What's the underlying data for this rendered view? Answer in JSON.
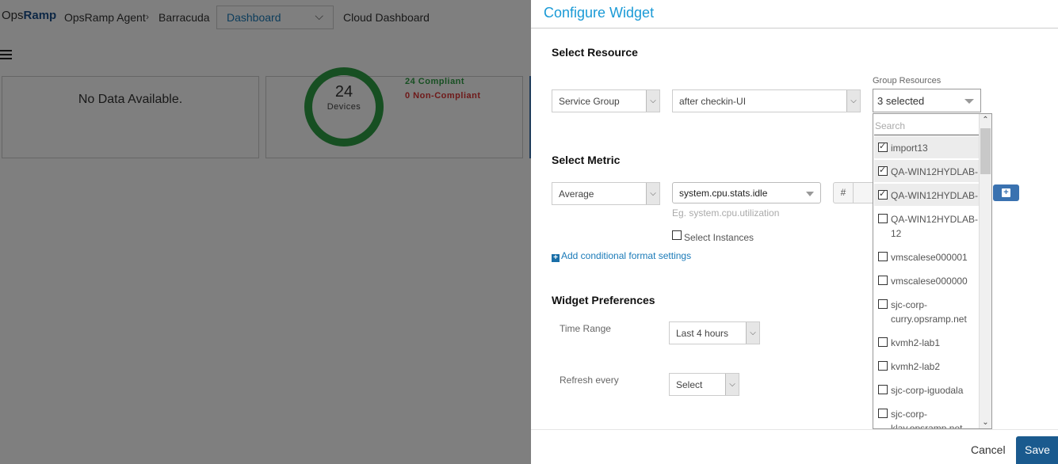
{
  "background": {
    "logo": {
      "prefix": "Ops",
      "suffix": "Ramp"
    },
    "breadcrumb": [
      "OpsRamp Agent",
      "Barracuda"
    ],
    "breadcrumb_separator": "›",
    "dashboard_select": {
      "value": "Dashboard"
    },
    "cloud_dashboard_link": "Cloud Dashboard",
    "widgets": [
      {
        "type": "no-data",
        "message": "No Data Available."
      },
      {
        "type": "compliance",
        "count": "24",
        "count_label": "Devices",
        "compliant": "24 Compliant",
        "non_compliant": "0 Non-Compliant",
        "compliant_color": "#2e9e44",
        "non_compliant_color": "#dd3333"
      }
    ]
  },
  "panel": {
    "title": "Configure Widget",
    "select_resource": {
      "heading": "Select Resource",
      "resource_type": "Service Group",
      "resource_name": "after checkin-UI",
      "group_resources": {
        "label": "Group Resources",
        "value": "3 selected",
        "search_placeholder": "Search",
        "items": [
          {
            "label": "import13",
            "checked": true
          },
          {
            "label": "QA-WIN12HYDLAB-",
            "checked": true
          },
          {
            "label": "QA-WIN12HYDLAB-",
            "checked": true
          },
          {
            "label": "QA-WIN12HYDLAB-12",
            "checked": false
          },
          {
            "label": "vmscalese000001",
            "checked": false
          },
          {
            "label": "vmscalese000000",
            "checked": false
          },
          {
            "label": "sjc-corp-curry.opsramp.net",
            "checked": false
          },
          {
            "label": "kvmh2-lab1",
            "checked": false
          },
          {
            "label": "kvmh2-lab2",
            "checked": false
          },
          {
            "label": "sjc-corp-iguodala",
            "checked": false
          },
          {
            "label": "sjc-corp-klay.opsramp.net",
            "checked": false
          }
        ]
      }
    },
    "select_metric": {
      "heading": "Select Metric",
      "aggregation": "Average",
      "metric": "system.cpu.stats.idle",
      "metric_hint": "Eg. system.cpu.utilization",
      "hash_label": "#",
      "select_instances_label": "Select Instances",
      "select_instances_checked": false,
      "add_conditional_label": "Add conditional format settings"
    },
    "widget_preferences": {
      "heading": "Widget Preferences",
      "time_range_label": "Time Range",
      "time_range_value": "Last 4 hours",
      "refresh_label": "Refresh every",
      "refresh_value": "Select"
    },
    "footer": {
      "cancel_label": "Cancel",
      "save_label": "Save"
    },
    "accent_color": "#1a9ad6",
    "primary_button_color": "#1a5a8e"
  }
}
